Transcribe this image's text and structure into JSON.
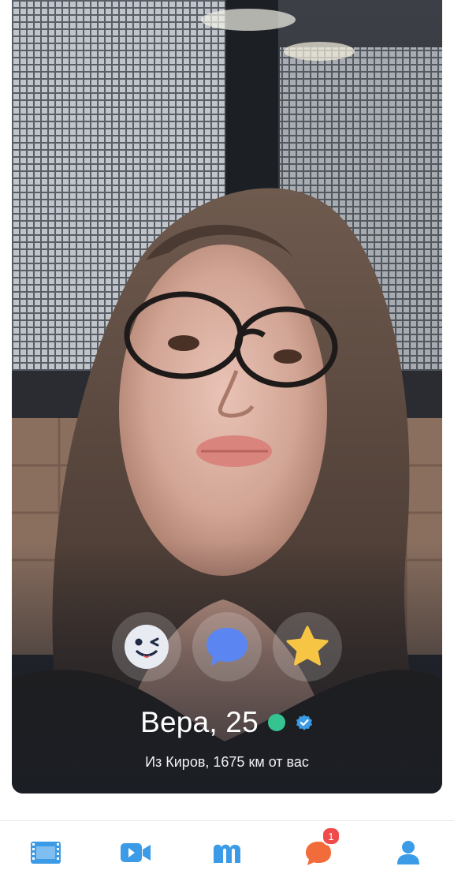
{
  "profile": {
    "name_age": "Вера, 25",
    "location": "Из Киров, 1675 км от вас",
    "online": true,
    "verified": true
  },
  "actions": [
    {
      "icon": "wink-face-icon"
    },
    {
      "icon": "chat-bubble-icon"
    },
    {
      "icon": "star-icon"
    }
  ],
  "tabbar": {
    "items": [
      {
        "icon": "film-strip-icon"
      },
      {
        "icon": "video-camera-icon"
      },
      {
        "icon": "m-logo-icon"
      },
      {
        "icon": "chat-icon",
        "badge": "1"
      },
      {
        "icon": "profile-icon"
      }
    ]
  },
  "colors": {
    "accent": "#3b9be6",
    "online": "#35c491",
    "badge": "#f04b4b",
    "chat_orange": "#f26b3a",
    "star": "#f6c544"
  }
}
